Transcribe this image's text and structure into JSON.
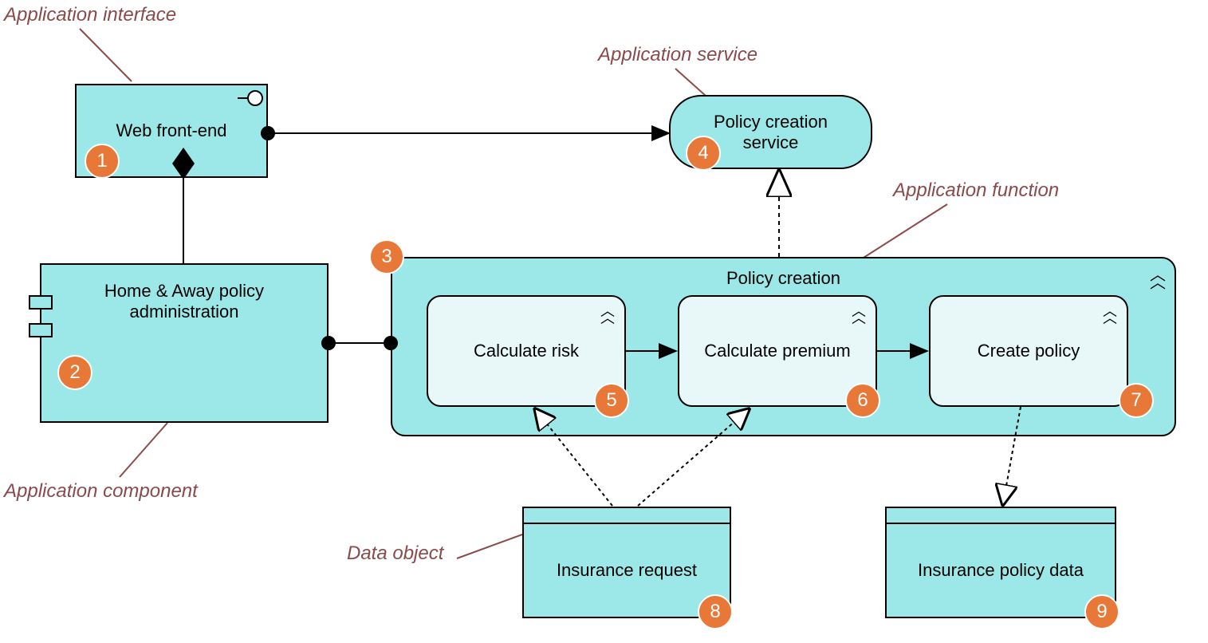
{
  "labels": {
    "appInterface": "Application interface",
    "appService": "Application service",
    "appComponent": "Application component",
    "appFunction": "Application function",
    "dataObject": "Data object"
  },
  "elements": {
    "webFrontEnd": "Web front-end",
    "policyCreationService": "Policy creation service",
    "homeAwayPolicy": "Home & Away policy administration",
    "policyCreation": "Policy creation",
    "calculateRisk": "Calculate risk",
    "calculatePremium": "Calculate premium",
    "createPolicy": "Create policy",
    "insuranceRequest": "Insurance request",
    "insurancePolicyData": "Insurance policy data"
  },
  "markers": {
    "m1": "1",
    "m2": "2",
    "m3": "3",
    "m4": "4",
    "m5": "5",
    "m6": "6",
    "m7": "7",
    "m8": "8",
    "m9": "9"
  }
}
